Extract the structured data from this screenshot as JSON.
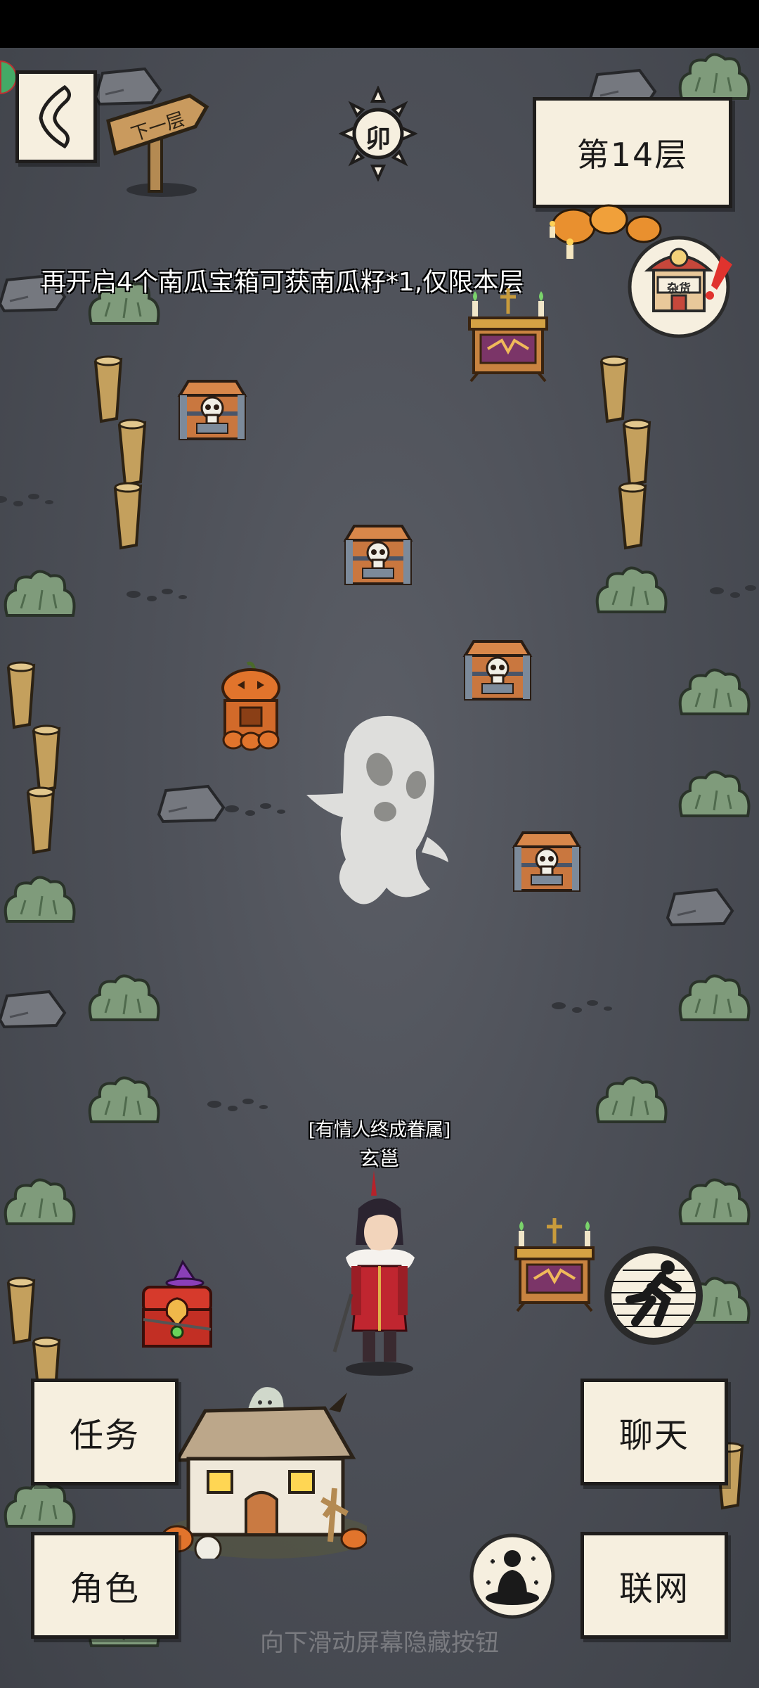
{
  "header": {
    "floor_label": "第14层",
    "sun_glyph": "卯",
    "sign_text": "下一层",
    "shop_sign": "杂货"
  },
  "notice": "再开启4个南瓜宝箱可获南瓜籽*1,仅限本层",
  "player": {
    "title": "[有情人终成眷属]",
    "name": "玄邕"
  },
  "buttons": {
    "task": "任务",
    "role": "角色",
    "chat": "聊天",
    "network": "联网"
  },
  "hint": "向下滑动屏幕隐藏按钮",
  "icons": {
    "back": "back-chevron-icon",
    "sprint": "sprint-runner-icon",
    "meditate": "meditate-icon",
    "shop": "shop-stall-icon"
  },
  "colors": {
    "paper": "#f6efdf",
    "ink": "#1f1d1c",
    "ground": "#4d5058",
    "chest": "#c9773f"
  }
}
